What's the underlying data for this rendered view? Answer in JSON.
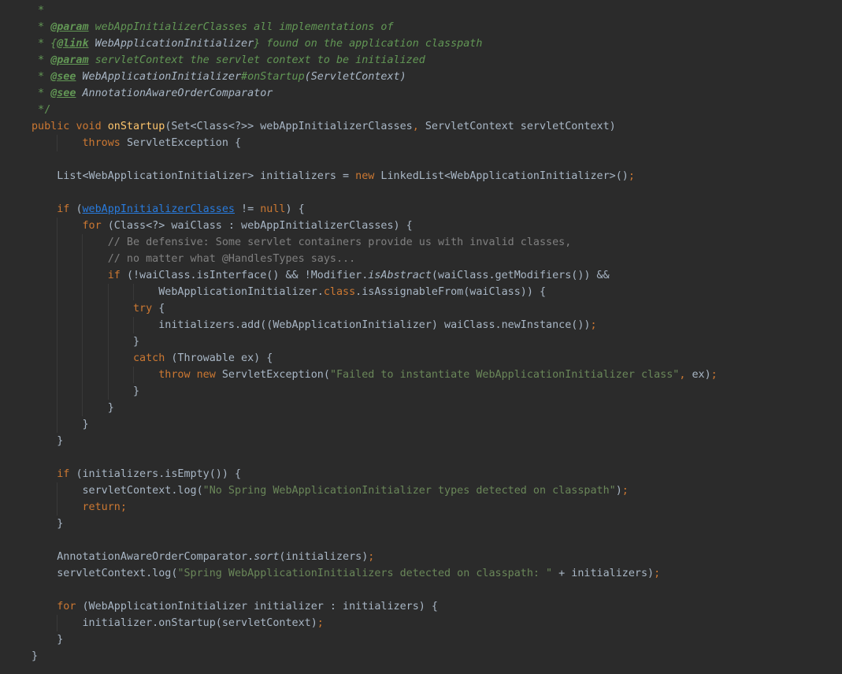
{
  "editor": {
    "lines": [
      [
        {
          "t": " *",
          "c": "docstar"
        }
      ],
      [
        {
          "t": " * ",
          "c": "docstar"
        },
        {
          "t": "@param",
          "c": "doctag"
        },
        {
          "t": " webAppInitializerClasses all implementations of",
          "c": "doc"
        }
      ],
      [
        {
          "t": " * {",
          "c": "doc"
        },
        {
          "t": "@link",
          "c": "doctag"
        },
        {
          "t": " WebApplicationInitializer",
          "c": "docref"
        },
        {
          "t": "} found on the application classpath",
          "c": "doc"
        }
      ],
      [
        {
          "t": " * ",
          "c": "docstar"
        },
        {
          "t": "@param",
          "c": "doctag"
        },
        {
          "t": " servletContext the servlet context to be initialized",
          "c": "doc"
        }
      ],
      [
        {
          "t": " * ",
          "c": "docstar"
        },
        {
          "t": "@see",
          "c": "doctag"
        },
        {
          "t": " WebApplicationInitializer",
          "c": "docref"
        },
        {
          "t": "#onStartup",
          "c": "doc"
        },
        {
          "t": "(ServletContext)",
          "c": "docref"
        }
      ],
      [
        {
          "t": " * ",
          "c": "docstar"
        },
        {
          "t": "@see",
          "c": "doctag"
        },
        {
          "t": " AnnotationAwareOrderComparator",
          "c": "docref"
        }
      ],
      [
        {
          "t": " */",
          "c": "docstar"
        }
      ],
      [
        {
          "t": "public ",
          "c": "kw"
        },
        {
          "t": "void ",
          "c": "kw"
        },
        {
          "t": "onStartup",
          "c": "method"
        },
        {
          "t": "(Set<Class<?>> webAppInitializerClasses",
          "c": "plain"
        },
        {
          "t": ", ",
          "c": "punct"
        },
        {
          "t": "ServletContext servletContext)",
          "c": "plain"
        }
      ],
      [
        {
          "t": "        ",
          "c": "plain"
        },
        {
          "t": "throws ",
          "c": "kw"
        },
        {
          "t": "ServletException {",
          "c": "plain"
        }
      ],
      [
        {
          "t": "",
          "c": "plain"
        }
      ],
      [
        {
          "t": "    List<WebApplicationInitializer> initializers = ",
          "c": "plain"
        },
        {
          "t": "new ",
          "c": "kw"
        },
        {
          "t": "LinkedList<WebApplicationInitializer>()",
          "c": "plain"
        },
        {
          "t": ";",
          "c": "punct"
        }
      ],
      [
        {
          "t": "",
          "c": "plain"
        }
      ],
      [
        {
          "t": "    ",
          "c": "plain"
        },
        {
          "t": "if ",
          "c": "kw"
        },
        {
          "t": "(",
          "c": "plain"
        },
        {
          "t": "webAppInitializerClasses",
          "c": "field"
        },
        {
          "t": " != ",
          "c": "plain"
        },
        {
          "t": "null",
          "c": "kw"
        },
        {
          "t": ") {",
          "c": "plain"
        }
      ],
      [
        {
          "t": "        ",
          "c": "plain"
        },
        {
          "t": "for ",
          "c": "kw"
        },
        {
          "t": "(Class<?> waiClass : webAppInitializerClasses) {",
          "c": "plain"
        }
      ],
      [
        {
          "t": "            // Be defensive: Some servlet containers provide us with invalid classes,",
          "c": "comment"
        }
      ],
      [
        {
          "t": "            // no matter what @HandlesTypes says...",
          "c": "comment"
        }
      ],
      [
        {
          "t": "            ",
          "c": "plain"
        },
        {
          "t": "if ",
          "c": "kw"
        },
        {
          "t": "(!waiClass.isInterface() && !Modifier.",
          "c": "plain"
        },
        {
          "t": "isAbstract",
          "c": "static"
        },
        {
          "t": "(waiClass.getModifiers()) &&",
          "c": "plain"
        }
      ],
      [
        {
          "t": "                    WebApplicationInitializer.",
          "c": "plain"
        },
        {
          "t": "class",
          "c": "kw"
        },
        {
          "t": ".isAssignableFrom(waiClass)) {",
          "c": "plain"
        }
      ],
      [
        {
          "t": "                ",
          "c": "plain"
        },
        {
          "t": "try ",
          "c": "kw"
        },
        {
          "t": "{",
          "c": "plain"
        }
      ],
      [
        {
          "t": "                    initializers.add((WebApplicationInitializer) waiClass.newInstance())",
          "c": "plain"
        },
        {
          "t": ";",
          "c": "punct"
        }
      ],
      [
        {
          "t": "                }",
          "c": "plain"
        }
      ],
      [
        {
          "t": "                ",
          "c": "plain"
        },
        {
          "t": "catch ",
          "c": "kw"
        },
        {
          "t": "(Throwable ex) {",
          "c": "plain"
        }
      ],
      [
        {
          "t": "                    ",
          "c": "plain"
        },
        {
          "t": "throw new ",
          "c": "kw"
        },
        {
          "t": "ServletException(",
          "c": "plain"
        },
        {
          "t": "\"Failed to instantiate WebApplicationInitializer class\"",
          "c": "str"
        },
        {
          "t": ", ",
          "c": "punct"
        },
        {
          "t": "ex)",
          "c": "plain"
        },
        {
          "t": ";",
          "c": "punct"
        }
      ],
      [
        {
          "t": "                }",
          "c": "plain"
        }
      ],
      [
        {
          "t": "            }",
          "c": "plain"
        }
      ],
      [
        {
          "t": "        }",
          "c": "plain"
        }
      ],
      [
        {
          "t": "    }",
          "c": "plain"
        }
      ],
      [
        {
          "t": "",
          "c": "plain"
        }
      ],
      [
        {
          "t": "    ",
          "c": "plain"
        },
        {
          "t": "if ",
          "c": "kw"
        },
        {
          "t": "(initializers.isEmpty()) {",
          "c": "plain"
        }
      ],
      [
        {
          "t": "        servletContext.log(",
          "c": "plain"
        },
        {
          "t": "\"No Spring WebApplicationInitializer types detected on classpath\"",
          "c": "str"
        },
        {
          "t": ")",
          "c": "plain"
        },
        {
          "t": ";",
          "c": "punct"
        }
      ],
      [
        {
          "t": "        ",
          "c": "plain"
        },
        {
          "t": "return;",
          "c": "kw"
        }
      ],
      [
        {
          "t": "    }",
          "c": "plain"
        }
      ],
      [
        {
          "t": "",
          "c": "plain"
        }
      ],
      [
        {
          "t": "    AnnotationAwareOrderComparator.",
          "c": "plain"
        },
        {
          "t": "sort",
          "c": "static"
        },
        {
          "t": "(initializers)",
          "c": "plain"
        },
        {
          "t": ";",
          "c": "punct"
        }
      ],
      [
        {
          "t": "    servletContext.log(",
          "c": "plain"
        },
        {
          "t": "\"Spring WebApplicationInitializers detected on classpath: \"",
          "c": "str"
        },
        {
          "t": " + initializers)",
          "c": "plain"
        },
        {
          "t": ";",
          "c": "punct"
        }
      ],
      [
        {
          "t": "",
          "c": "plain"
        }
      ],
      [
        {
          "t": "    ",
          "c": "plain"
        },
        {
          "t": "for ",
          "c": "kw"
        },
        {
          "t": "(WebApplicationInitializer initializer : initializers) {",
          "c": "plain"
        }
      ],
      [
        {
          "t": "        initializer.onStartup(servletContext)",
          "c": "plain"
        },
        {
          "t": ";",
          "c": "punct"
        }
      ],
      [
        {
          "t": "    }",
          "c": "plain"
        }
      ],
      [
        {
          "t": "}",
          "c": "plain"
        }
      ]
    ],
    "colors": {
      "background": "#2b2b2b",
      "text": "#a9b7c6",
      "keyword": "#cc7832",
      "method": "#ffc66d",
      "string": "#6a8759",
      "comment": "#808080",
      "doc": "#629755",
      "field": "#287bde"
    }
  }
}
